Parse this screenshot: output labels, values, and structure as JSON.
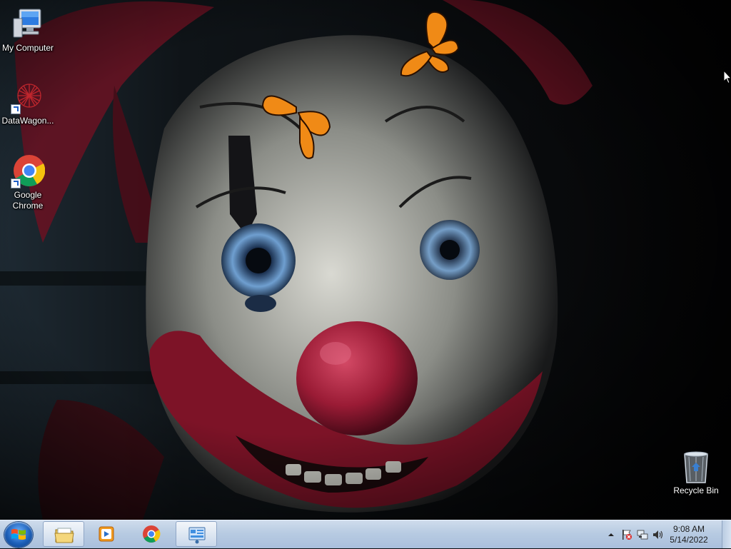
{
  "desktop": {
    "icons": [
      {
        "label": "My Computer",
        "icon": "computer-icon"
      },
      {
        "label": "DataWagon...",
        "icon": "datawagon-icon"
      },
      {
        "label": "Google Chrome",
        "icon": "chrome-icon"
      },
      {
        "label": "Recycle Bin",
        "icon": "recycle-bin-icon"
      }
    ]
  },
  "taskbar": {
    "start": {
      "icon": "windows-logo-icon"
    },
    "pinned": [
      {
        "name": "Windows Explorer",
        "icon": "folder-icon",
        "active": true
      },
      {
        "name": "Windows Media Player",
        "icon": "media-player-icon",
        "active": false
      },
      {
        "name": "Google Chrome",
        "icon": "chrome-icon",
        "active": false
      },
      {
        "name": "Control Panel",
        "icon": "control-panel-icon",
        "active": true
      }
    ],
    "tray": {
      "icons": [
        "chevron-up-icon",
        "action-center-flag-icon",
        "network-icon",
        "volume-icon"
      ],
      "time": "9:08 AM",
      "date": "5/14/2022"
    }
  },
  "colors": {
    "taskbar": "#b8cbe2",
    "butterfly": "#f08a16",
    "clown_nose": "#9a1b35"
  }
}
